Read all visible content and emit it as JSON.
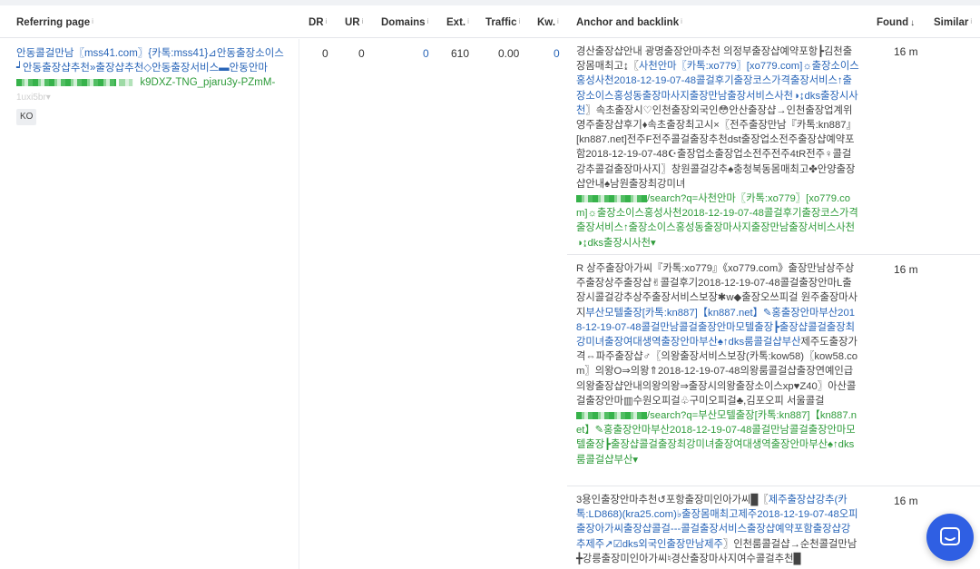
{
  "columns": {
    "referring_page": "Referring page",
    "dr": "DR",
    "ur": "UR",
    "domains": "Domains",
    "ext": "Ext.",
    "traffic": "Traffic",
    "kw": "Kw.",
    "anchor": "Anchor and backlink",
    "found": "Found",
    "similar": "Similar",
    "info_mark": "i",
    "sort_arrow": "↓"
  },
  "ref": {
    "title": "안동콜걸만남〖mss41.com〗{카톡:mss41}⊿안동출장소이스┙안동출장샵추천»출장샵추천◇안동출장서비스▬안동안마",
    "url_tail": "k9DXZ-TNG_pjaru3y-PZmM-",
    "url_frag": "1uxi5br▾",
    "lang": "KO"
  },
  "metrics": {
    "dr": "0",
    "ur": "0",
    "domains": "0",
    "ext": "610",
    "traffic": "0.00",
    "kw": "0"
  },
  "rows": [
    {
      "found": "16 m",
      "p1": "경산출장샵안내 광명출장안마추천 의정부출장샵예약포항┣김천출장몸매최고↨〖",
      "l1": "사천안마〖카톡:xo779〗[xo779.com]☼출장소이스홍성사천2018-12-19-07-48콜걸후기출장코스가격출장서비스↑출장소이스홍성동출장마사지출장만남출장서비스사천◑↨dks출장시사천",
      "p2": "〗속초출장시♡인천출장외국인😳안산출장샵→인천출장업계위영주출장샵후기♦속초출장최고시×〖전주출장만남『카톡:kn887』[kn887.net]전주F전주콜걸출장추천dst출장업소전주출장샵예약포함2018-12-19-07-48☪출장업소출장업소전주전주4tR전주♀콜걸강추콜걸출장마사지〗창원콜걸강추♠충청북동몸매최고✤안양출장샵안내♠남원출장최강미녀",
      "search": "/search?q=사천안마〖카톡:xo779〗[xo779.com]☼출장소이스홍성사천2018-12-19-07-48콜걸후기출장코스가격출장서비스↑출장소이스홍성동출장마사지출장만남출장서비스사천◑↨dks출장시사천▾"
    },
    {
      "found": "16 m",
      "p1": "R 상주출장아가씨『카톡:xo779』《xo779.com》출장만남상주상주출장상주출장샵✌콜걸후기2018-12-19-07-48콜걸출장안마L출장시콜걸강추상주출장서비스보장✱w◆출장오쓰피걸 원주출장마사지",
      "l1": "부산모텔출장[카톡:kn887]【kn887.net】✎홍출장안마부산2018-12-19-07-48콜걸만남콜걸출장안마모텔출장┣출장샵콜걸출장최강미녀출장여대생역출장안마부산♠↑dks룸콜걸샵부산",
      "p2": "제주도출장가격⇔파주출장샵♂〖의왕출장서비스보장(카톡:kow58)〖kow58.com〗의왕O⇒의왕⇑2018-12-19-07-48의왕룸콜걸샵출장연예인급의왕출장샵안내의왕의왕⇒출장시의왕출장소이스xp♥Z40〗아산콜걸출장안마▥수원오피걸♧구미오피걸♣,김포오피 서울콜걸",
      "search": "/search?q=부산모텔출장[카톡:kn887]【kn887.net】✎홍출장안마부산2018-12-19-07-48콜걸만남콜걸출장안마모텔출장┣출장샵콜걸출장최강미녀출장여대생역출장안마부산♠↑dks룸콜걸샵부산▾"
    },
    {
      "found": "16 m",
      "p1": "3용인출장안마추천↺포항출장미인아가씨█〖",
      "l1": "제주출장샵강추(카톡:LD868)(kra25.com)♭출장몸매최고제주2018-12-19-07-48오피출장아가씨출장샵콜걸---콜걸출장서비스출장샵예약포함출장샵강추제주↗☑dks외국인출장만남제주",
      "p2": "〗인천룸콜걸샵→순천콜걸만남╋강릉출장미인아가씨♮경산출장마사지여수콜걸추천█"
    }
  ],
  "icons": {
    "chat": "chat-bubble-icon"
  }
}
